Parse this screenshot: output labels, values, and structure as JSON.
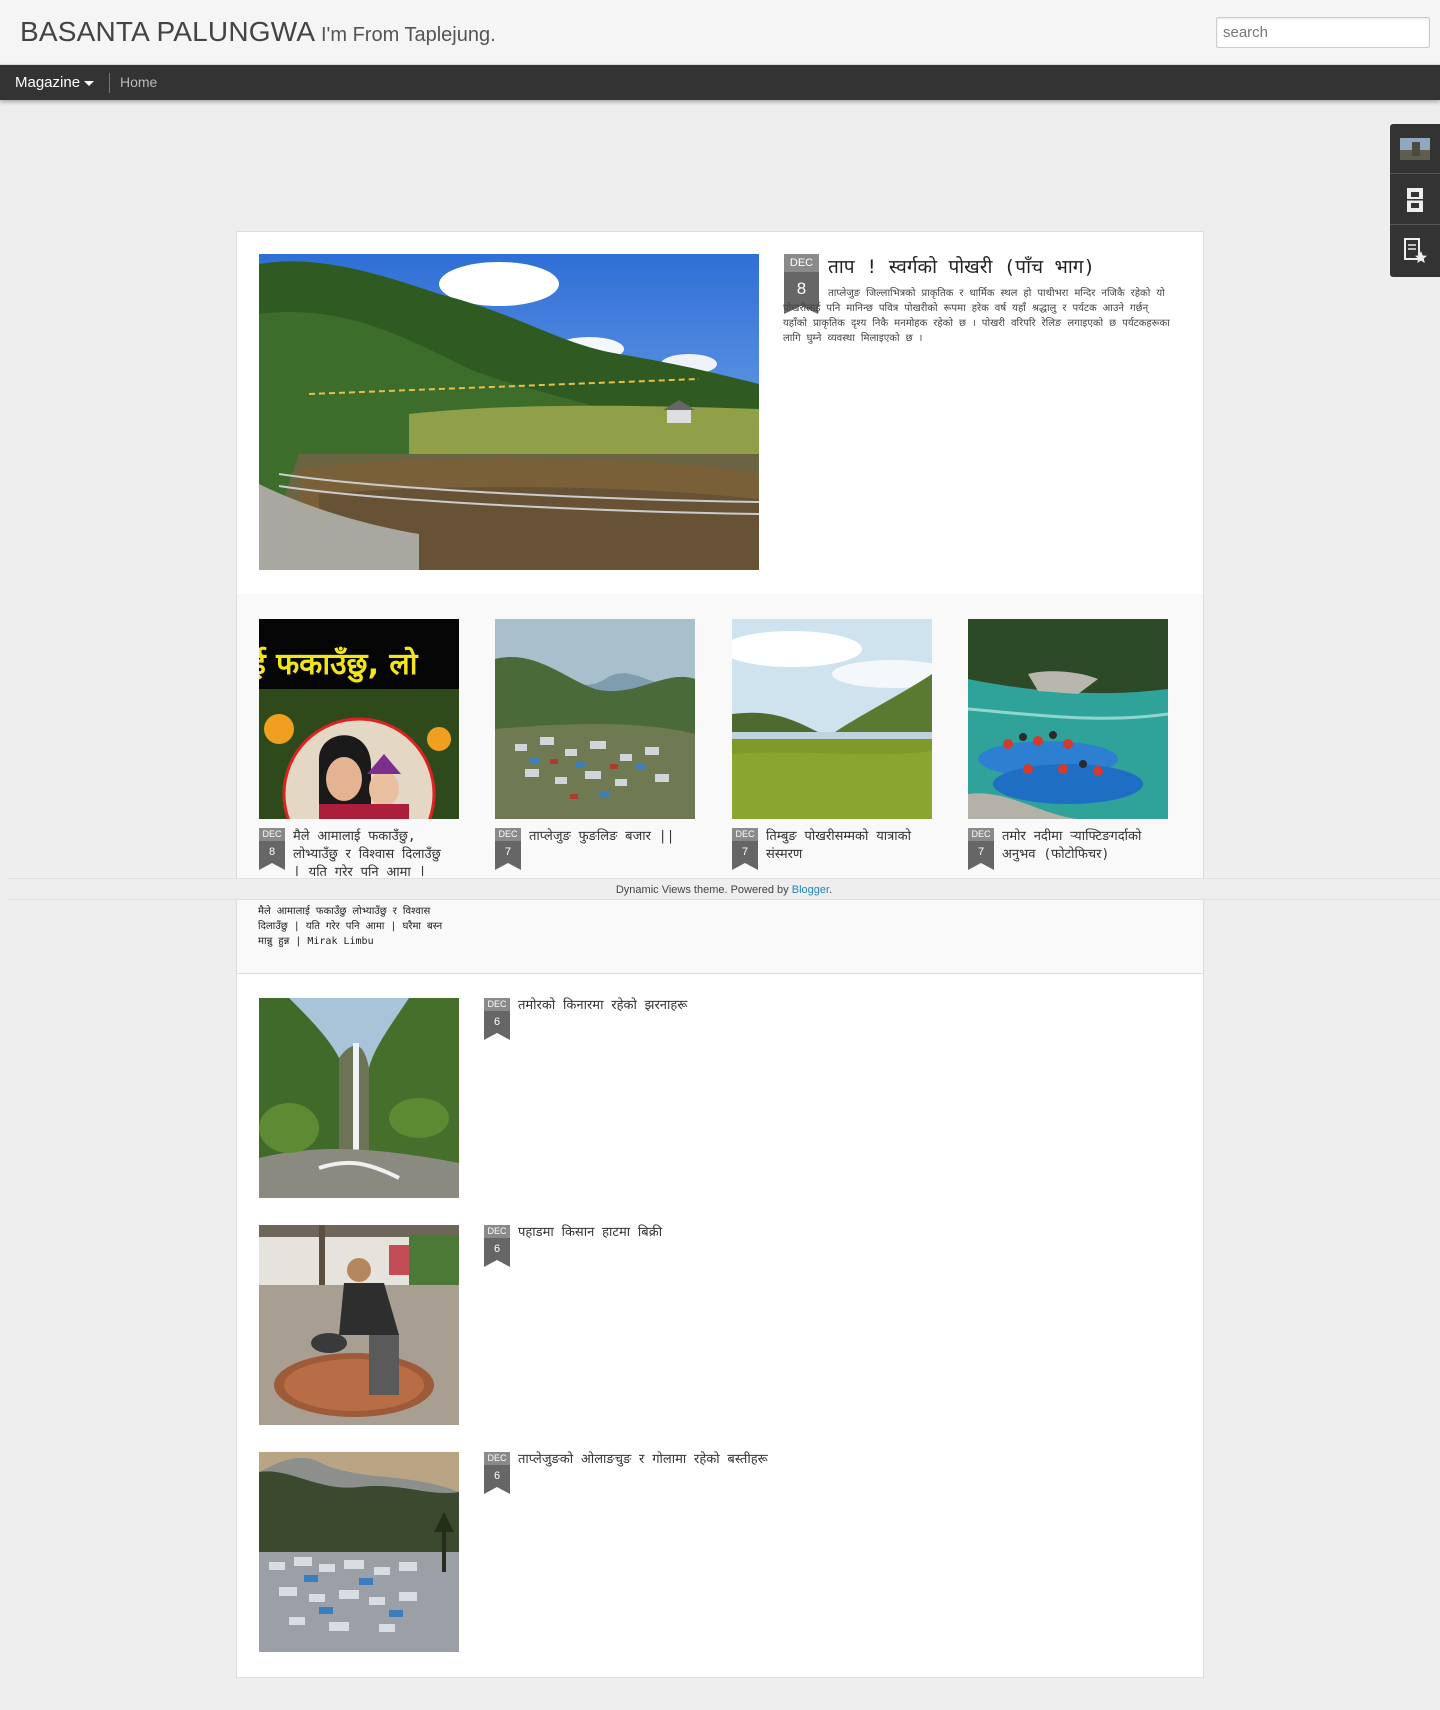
{
  "header": {
    "blog_title": "BASANTA PALUNGWA",
    "blog_description": "I'm From Taplejung.",
    "search_placeholder": "search"
  },
  "nav": {
    "view_label": "Magazine",
    "home_label": "Home"
  },
  "side_widgets": [
    {
      "icon": "thumbnail-icon"
    },
    {
      "icon": "archive-icon"
    },
    {
      "icon": "subscribe-icon"
    }
  ],
  "featured": {
    "month": "DEC",
    "day": "8",
    "title": "ताप ! स्वर्गको पोखरी (पाँच भाग)",
    "snippet": "ताप्लेजुङ जिल्लाभित्रको प्राकृतिक र धार्मिक स्थल हो पाथीभरा मन्दिर नजिकै रहेको यो पोखरीलाई पनि मानिन्छ पवित्र पोखरीको रूपमा हरेक वर्ष यहाँ श्रद्धालु र पर्यटक आउने गर्छन् यहाँको प्राकृतिक दृश्य निकै मनमोहक रहेको छ । पोखरी वरिपरि रेलिङ लगाइएको छ पर्यटकहरूका लागि घुम्ने व्यवस्था मिलाइएको छ ।"
  },
  "grid_posts": [
    {
      "month": "DEC",
      "day": "8",
      "title": "मैले आमालाई फकाउँछु, लोभ्याउँछु र विश्वास दिलाउँछु | यति गरेर पनि आमा | मिराक लिम्बु"
    },
    {
      "month": "DEC",
      "day": "7",
      "title": "ताप्लेजुङ फुङलिङ बजार ||"
    },
    {
      "month": "DEC",
      "day": "7",
      "title": "तिम्बुङ पोखरीसम्मको यात्राको संस्मरण"
    },
    {
      "month": "DEC",
      "day": "7",
      "title": "तमोर नदीमा र्‍याफ्टिङगर्दाको अनुभव (फोटोफिचर)"
    }
  ],
  "grid_snippet": {
    "text": "मैले आमालाई फकाउँछु लोभ्याउँछु र विश्वास दिलाउँछु | यति गरेर पनि आमा | घरैमा बस्न मान्नु हुन्न | Mirak Limbu"
  },
  "list_posts": [
    {
      "month": "DEC",
      "day": "6",
      "title": "तमोरको किनारमा रहेको झरनाहरू"
    },
    {
      "month": "DEC",
      "day": "6",
      "title": "पहाडमा किसान हाटमा बिक्री"
    },
    {
      "month": "DEC",
      "day": "6",
      "title": "ताप्लेजुङको ओलाङचुङ र गोलामा रहेको बस्तीहरू"
    }
  ],
  "footer": {
    "theme_text": "Dynamic Views theme. Powered by",
    "link_label": "Blogger",
    "end": "."
  },
  "colors": {
    "header_bg": "#f5f5f5",
    "nav_bg": "#333333",
    "page_bg": "#eeeeee",
    "link": "#2288bb"
  }
}
